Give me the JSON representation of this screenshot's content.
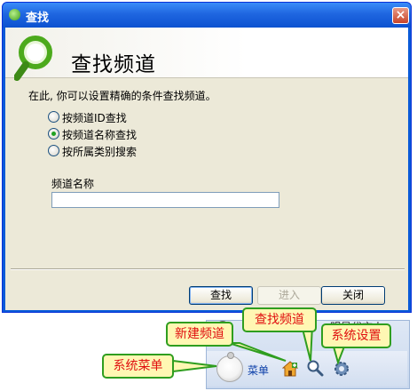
{
  "window": {
    "title": "查找",
    "close_glyph": "×"
  },
  "banner": {
    "title": "查找频道"
  },
  "description": "在此, 你可以设置精确的条件查找频道。",
  "search_options": [
    {
      "label": "按频道ID查找",
      "selected": false
    },
    {
      "label": "按频道名称查找",
      "selected": true
    },
    {
      "label": "按所属类别搜索",
      "selected": false
    }
  ],
  "channel_name": {
    "label": "频道名称",
    "value": ""
  },
  "buttons": {
    "find": "查找",
    "enter": "进入",
    "close": "关闭"
  },
  "taskbar": {
    "menu_label": "菜单",
    "top_text": "明星代言人"
  },
  "callouts": {
    "system_menu": "系统菜单",
    "new_channel": "新建频道",
    "find_channel": "查找频道",
    "system_settings": "系统设置"
  },
  "colors": {
    "callout_text": "#e01010",
    "callout_border": "#2f9e1f",
    "callout_fill": "#fff7b3",
    "titlebar": "#0c52d0"
  }
}
